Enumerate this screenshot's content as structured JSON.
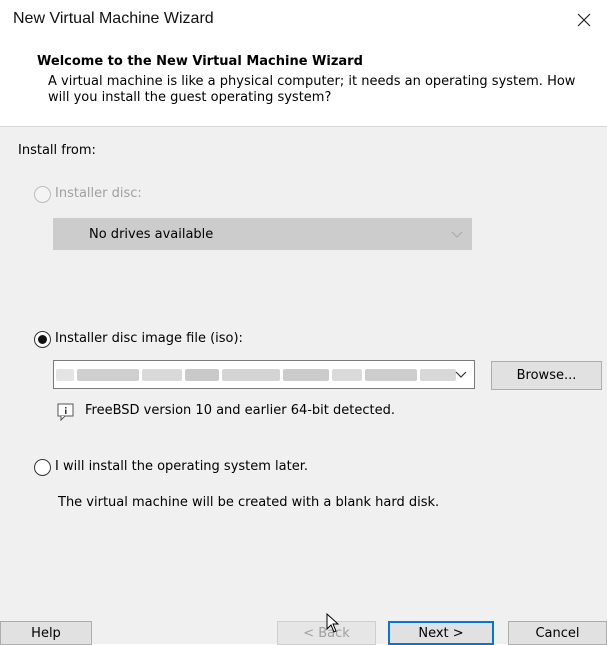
{
  "window": {
    "title": "New Virtual Machine Wizard"
  },
  "header": {
    "title": "Welcome to the New Virtual Machine Wizard",
    "description": "A virtual machine is like a physical computer; it needs an operating system. How will you install the guest operating system?"
  },
  "install": {
    "label": "Install from:",
    "disc": {
      "label": "Installer disc:",
      "selected": false,
      "enabled": false,
      "dropdown_value": "No drives available"
    },
    "iso": {
      "label": "Installer disc image file (iso):",
      "selected": true,
      "path": "",
      "browse_label": "Browse...",
      "detected_text": "FreeBSD version 10 and earlier 64-bit detected."
    },
    "later": {
      "label": "I will install the operating system later.",
      "selected": false,
      "note": "The virtual machine will be created with a blank hard disk."
    }
  },
  "footer": {
    "help": "Help",
    "back": "< Back",
    "next": "Next >",
    "cancel": "Cancel"
  },
  "icons": {
    "close": "close-icon",
    "chevron": "chevron-down-icon",
    "info": "info-icon",
    "cursor": "mouse-cursor-icon"
  },
  "colors": {
    "accent": "#0078d7",
    "panel": "#f0f0f0",
    "disabled_combo": "#cccccc"
  }
}
